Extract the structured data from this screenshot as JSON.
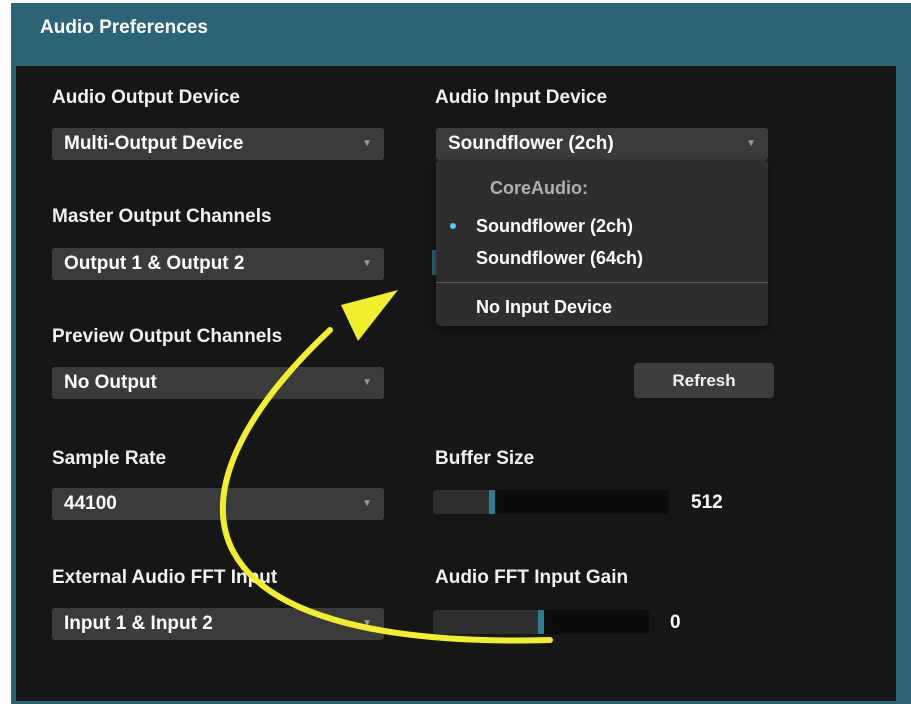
{
  "window": {
    "title": "Audio Preferences"
  },
  "output_device": {
    "label": "Audio Output Device",
    "value": "Multi-Output Device"
  },
  "input_device": {
    "label": "Audio Input Device",
    "value": "Soundflower (2ch)",
    "menu": {
      "group_header": "CoreAudio:",
      "items": [
        "Soundflower (2ch)",
        "Soundflower (64ch)"
      ],
      "selected_index": 0,
      "none_item": "No Input Device"
    }
  },
  "master_output": {
    "label": "Master Output Channels",
    "value": "Output 1 & Output 2"
  },
  "preview_output": {
    "label": "Preview Output Channels",
    "value": "No Output"
  },
  "refresh_button": {
    "label": "Refresh"
  },
  "sample_rate": {
    "label": "Sample Rate",
    "value": "44100"
  },
  "buffer_size": {
    "label": "Buffer Size",
    "value": "512",
    "level": 0.25
  },
  "fft_input": {
    "label": "External Audio FFT Input",
    "value": "Input 1 & Input 2"
  },
  "fft_gain": {
    "label": "Audio FFT Input Gain",
    "value": "0",
    "level": 0.5
  },
  "colors": {
    "window_bg": "#2a6476",
    "panel_bg": "#161616",
    "accent": "#2c7f93",
    "annotation_arrow": "#f2ef2c",
    "selection_bullet": "#5ac8fa"
  }
}
